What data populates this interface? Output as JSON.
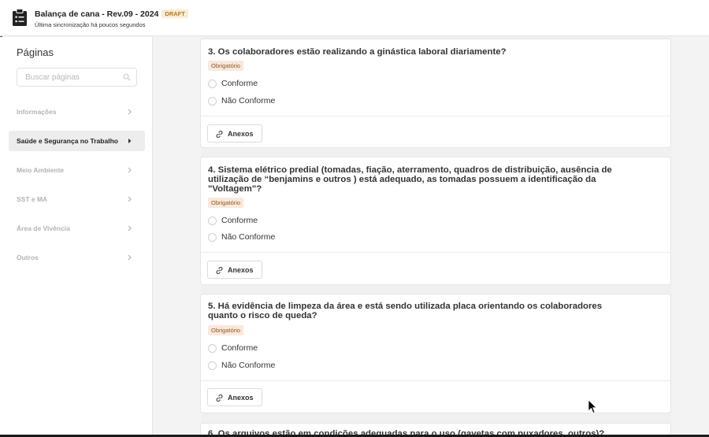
{
  "header": {
    "title": "Balança de cana - Rev.09 - 2024",
    "badge": "DRAFT",
    "subtitle": "Última sincronização há poucos segundos",
    "icon": "clipboard-icon"
  },
  "sidebar": {
    "heading": "Páginas",
    "search_placeholder": "Buscar páginas",
    "items": [
      {
        "label": "Informações",
        "active": false
      },
      {
        "label": "Saúde e Segurança no Trabalho",
        "active": true
      },
      {
        "label": "Meio Ambiente",
        "active": false
      },
      {
        "label": "SST e MA",
        "active": false
      },
      {
        "label": "Área de Vivência",
        "active": false
      },
      {
        "label": "Outros",
        "active": false
      }
    ]
  },
  "questions": [
    {
      "title_lines": [
        "3. Os colaboradores estão realizando a ginástica laboral diariamente?"
      ],
      "badge": "Obrigatório",
      "options": [
        "Conforme",
        "Não Conforme"
      ],
      "attachments_label": "Anexos"
    },
    {
      "title_lines": [
        "4. Sistema elétrico predial (tomadas, fiação, aterramento, quadros de distribuição, ausência de",
        "utilização de “benjamins e outros ) está adequado, as tomadas possuem a identificação da",
        "\"Voltagem\"?"
      ],
      "badge": "Obrigatório",
      "options": [
        "Conforme",
        "Não Conforme"
      ],
      "attachments_label": "Anexos"
    },
    {
      "title_lines": [
        "5. Há evidência de limpeza da área e está sendo utilizada placa orientando os colaboradores",
        "quanto o risco de queda?"
      ],
      "badge": "Obrigatório",
      "options": [
        "Conforme",
        "Não Conforme"
      ],
      "attachments_label": "Anexos"
    },
    {
      "title_lines": [
        "6. Os arquivos estão em condições adequadas para o uso (gavetas com puxadores, outros)?"
      ]
    }
  ]
}
